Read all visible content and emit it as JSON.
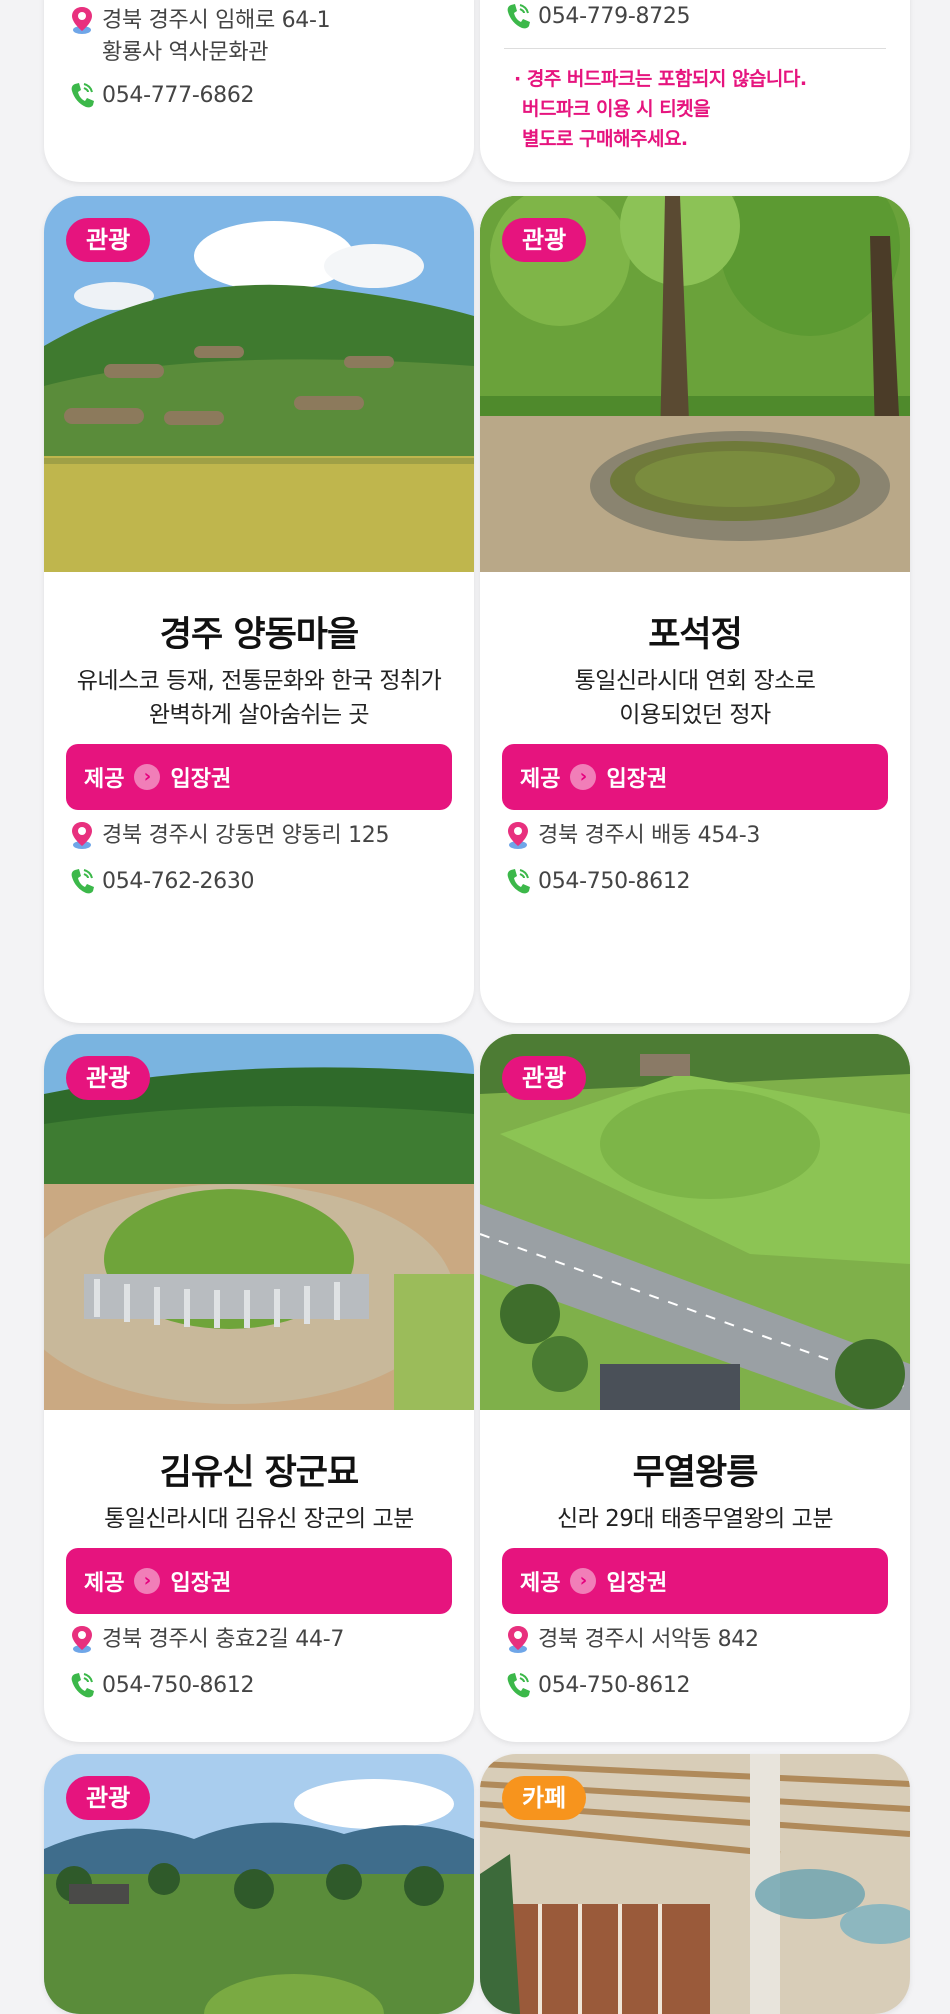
{
  "colors": {
    "accent": "#e6147e",
    "cafe": "#f7941d",
    "page_bg": "#f3f3f5"
  },
  "top_cards": [
    {
      "address_line1": "경북 경주시 임해로 64-1",
      "address_line2": "황룡사 역사문화관",
      "phone": "054-777-6862"
    },
    {
      "phone": "054-779-8725",
      "note_line1": "· 경주 버드파크는 포함되지 않습니다.",
      "note_line2": "버드파크 이용 시 티켓을",
      "note_line3": "별도로 구매해주세요."
    }
  ],
  "cards": [
    {
      "badge": "관광",
      "title": "경주 양동마을",
      "desc_line1": "유네스코 등재, 전통문화와 한국 정취가",
      "desc_line2": "완벽하게 살아숨쉬는 곳",
      "provide_label": "제공",
      "provide_arrow": "›",
      "provide_value": "입장권",
      "address": "경북 경주시 강동면 양동리 125",
      "phone": "054-762-2630",
      "image": "village-landscape"
    },
    {
      "badge": "관광",
      "title": "포석정",
      "desc_line1": "통일신라시대 연회 장소로",
      "desc_line2": "이용되었던 정자",
      "provide_label": "제공",
      "provide_arrow": "›",
      "provide_value": "입장권",
      "address": "경북 경주시 배동 454-3",
      "phone": "054-750-8612",
      "image": "forest-stone-channel"
    },
    {
      "badge": "관광",
      "title": "김유신 장군묘",
      "desc_line1": "통일신라시대 김유신 장군의 고분",
      "provide_label": "제공",
      "provide_arrow": "›",
      "provide_value": "입장권",
      "address": "경북 경주시 충효2길 44-7",
      "phone": "054-750-8612",
      "image": "royal-tomb-mound"
    },
    {
      "badge": "관광",
      "title": "무열왕릉",
      "desc_line1": "신라 29대 태종무열왕의 고분",
      "provide_label": "제공",
      "provide_arrow": "›",
      "provide_value": "입장권",
      "address": "경북 경주시 서악동 842",
      "phone": "054-750-8612",
      "image": "aerial-tomb-road"
    }
  ],
  "bottom_cards": [
    {
      "badge": "관광",
      "image": "mountain-park"
    },
    {
      "badge": "카페",
      "image": "cafe-interior"
    }
  ]
}
